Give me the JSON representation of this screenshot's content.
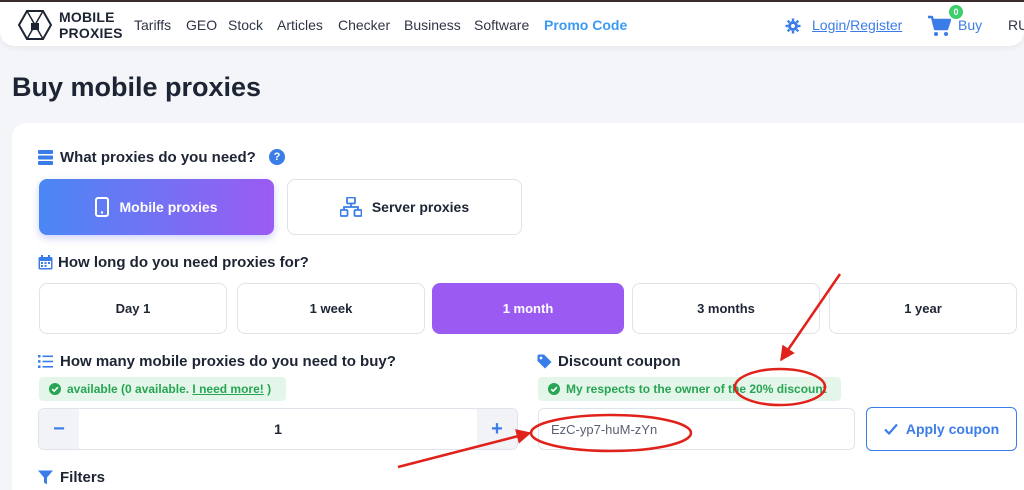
{
  "header": {
    "brand_line1": "MOBILE",
    "brand_line2": "PROXIES",
    "nav": [
      "Tariffs",
      "GEO",
      "Stock",
      "Articles",
      "Checker",
      "Business",
      "Software",
      "Promo Code"
    ],
    "login": "Login",
    "separator": "/",
    "register": "Register",
    "cart_count": "0",
    "buy": "Buy",
    "lang": "RU"
  },
  "page": {
    "title": "Buy mobile proxies"
  },
  "proxy_type": {
    "title": "What proxies do you need?",
    "help": "?",
    "options": [
      "Mobile proxies",
      "Server proxies"
    ],
    "selected": "Mobile proxies"
  },
  "duration": {
    "title": "How long do you need proxies for?",
    "options": [
      "Day 1",
      "1 week",
      "1 month",
      "3 months",
      "1 year"
    ],
    "selected": "1 month"
  },
  "quantity": {
    "title": "How many mobile proxies do you need to buy?",
    "status_prefix": "available (0 available. ",
    "status_link": "I need more!",
    "status_suffix": " )",
    "minus": "−",
    "value": "1",
    "plus": "+"
  },
  "coupon": {
    "title": "Discount coupon",
    "message": "My respects to the owner of the 20% discount",
    "value": "EzC-yp7-huM-zYn",
    "apply_label": "Apply coupon"
  },
  "filters": {
    "title": "Filters"
  },
  "colors": {
    "accent": "#3b7de8",
    "gradient_start": "#4b87f5",
    "gradient_end": "#9b5bf3",
    "annotation": "#e0221b",
    "success": "#26a552"
  }
}
